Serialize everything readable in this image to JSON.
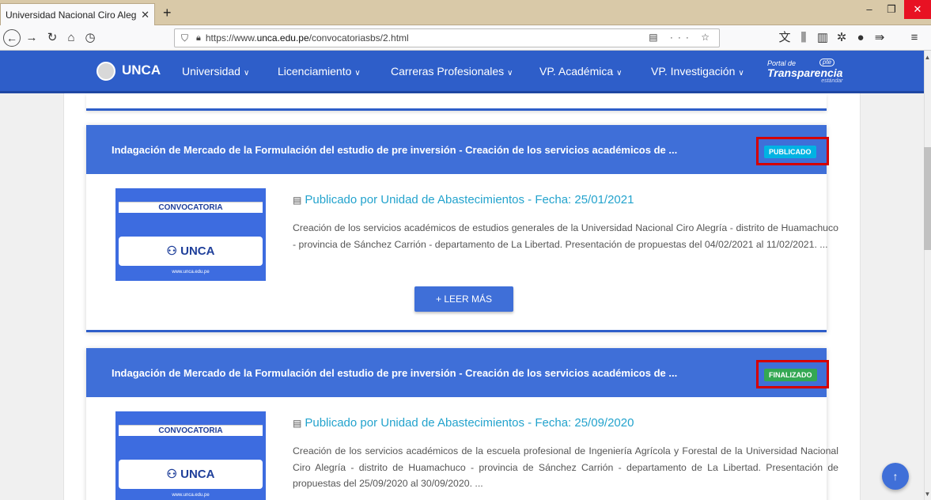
{
  "browser": {
    "tab_title": "Universidad Nacional Ciro Alegría",
    "tab_close": "✕",
    "new_tab": "+",
    "url_prefix": "https://www.",
    "url_host": "unca.edu.pe",
    "url_path": "/convocatoriasbs/2.html",
    "url_actions": "▤ ··· ☆",
    "window_controls": [
      "–",
      "❐",
      "✕"
    ]
  },
  "header": {
    "logo": "UNCA",
    "menu": [
      {
        "label": "Universidad"
      },
      {
        "label": "Licenciamiento"
      },
      {
        "label": "Carreras Profesionales"
      },
      {
        "label": "VP. Académica"
      },
      {
        "label": "VP. Investigación"
      }
    ],
    "transparencia": {
      "portal": "Portal de",
      "title": "Transparencia",
      "pte": "pte",
      "sub": "estándar"
    }
  },
  "cards": [
    {
      "title": "Indagación de Mercado de la Formulación del estudio de pre inversión - Creación de los servicios académicos de ...",
      "status": "PUBLICADO",
      "meta": "Publicado por Unidad de Abastecimientos - Fecha: 25/01/2021",
      "text": "Creación de los servicios académicos de estudios generales de la Universidad Nacional Ciro Alegría - distrito de Huamachuco - provincia de Sánchez Carrión - departamento de La Libertad. Presentación de propuestas del 04/02/2021 al 11/02/2021. ...",
      "button": "+ LEER MÁS",
      "thumb": {
        "banner": "CONVOCATORIA",
        "logo": "UNCA",
        "url": "www.unca.edu.pe"
      }
    },
    {
      "title": "Indagación de Mercado de la Formulación del estudio de pre inversión - Creación de los servicios académicos de ...",
      "status": "FINALIZADO",
      "meta": "Publicado por Unidad de Abastecimientos - Fecha: 25/09/2020",
      "text": "Creación de los servicios académicos de la escuela profesional de Ingeniería Agrícola y Forestal de la Universidad Nacional Ciro Alegría - distrito de Huamachuco - provincia de Sánchez Carrión - departamento de La Libertad. Presentación de propuestas del 25/09/2020 al 30/09/2020. ...",
      "thumb": {
        "banner": "CONVOCATORIA",
        "logo": "UNCA",
        "url": "www.unca.edu.pe"
      }
    }
  ],
  "colors": {
    "header": "#2e5ec9",
    "card_head": "#3f6fd8",
    "published": "#00b3e3",
    "finished": "#34a853",
    "highlight": "#d50000"
  }
}
